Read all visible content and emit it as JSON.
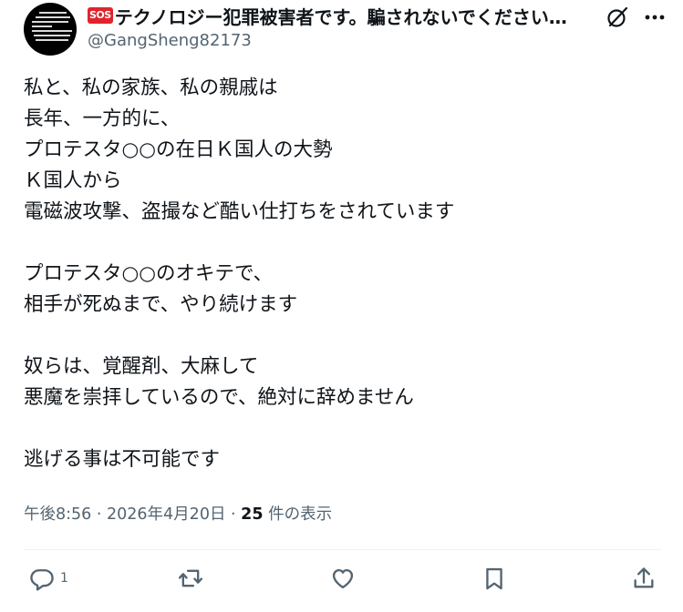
{
  "author": {
    "badge": "SOS",
    "display_name": "テクノロジー犯罪被害者です。騙されないでください…",
    "handle": "@GangSheng82173"
  },
  "tweet": {
    "text": "私と、私の家族、私の親戚は\n長年、一方的に、\nプロテスタ○○の在日Ｋ国人の大勢\nＫ国人から\n電磁波攻撃、盗撮など酷い仕打ちをされています\n\nプロテスタ○○のオキテで、\n相手が死ぬまで、やり続けます\n\n奴らは、覚醒剤、大麻して\n悪魔を崇拝しているので、絶対に辞めません\n\n逃げる事は不可能です",
    "time": "午後8:56",
    "separator1": " · ",
    "date": "2026年4月20日",
    "separator2": " · ",
    "views_count": "25",
    "views_label": " 件の表示"
  },
  "actions": {
    "reply_count": "1",
    "reply_icon": "reply-icon",
    "retweet_icon": "retweet-icon",
    "like_icon": "heart-icon",
    "bookmark_icon": "bookmark-icon",
    "share_icon": "share-icon"
  },
  "colors": {
    "text": "#0f1419",
    "secondary": "#536471",
    "sos_red": "#e0242b"
  }
}
